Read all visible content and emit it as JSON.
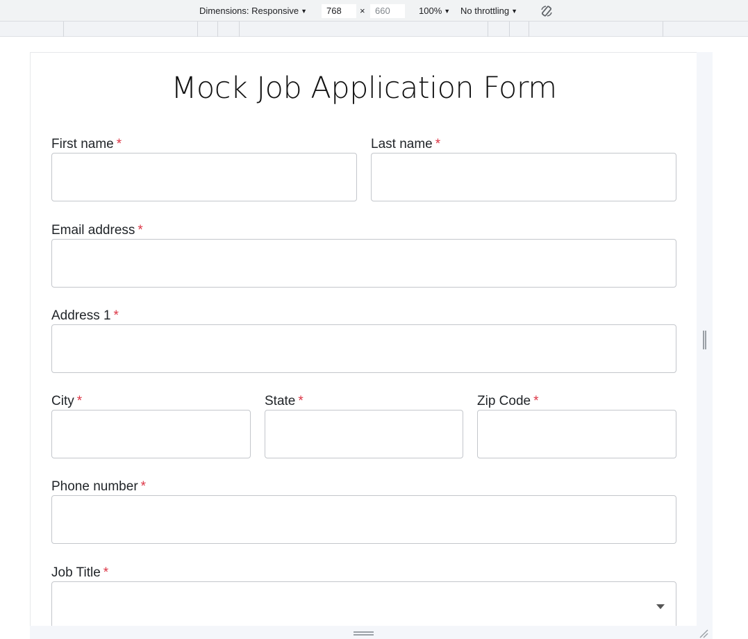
{
  "devtools": {
    "dimensions_label": "Dimensions: Responsive",
    "width_value": "768",
    "times": "×",
    "height_value": "660",
    "zoom": "100%",
    "throttling": "No throttling"
  },
  "form": {
    "title": "Mock Job Application Form",
    "required_marker": "*",
    "fields": {
      "first_name": "First name",
      "last_name": "Last name",
      "email": "Email address",
      "address1": "Address 1",
      "city": "City",
      "state": "State",
      "zip": "Zip Code",
      "phone": "Phone number",
      "job_title": "Job Title"
    }
  }
}
